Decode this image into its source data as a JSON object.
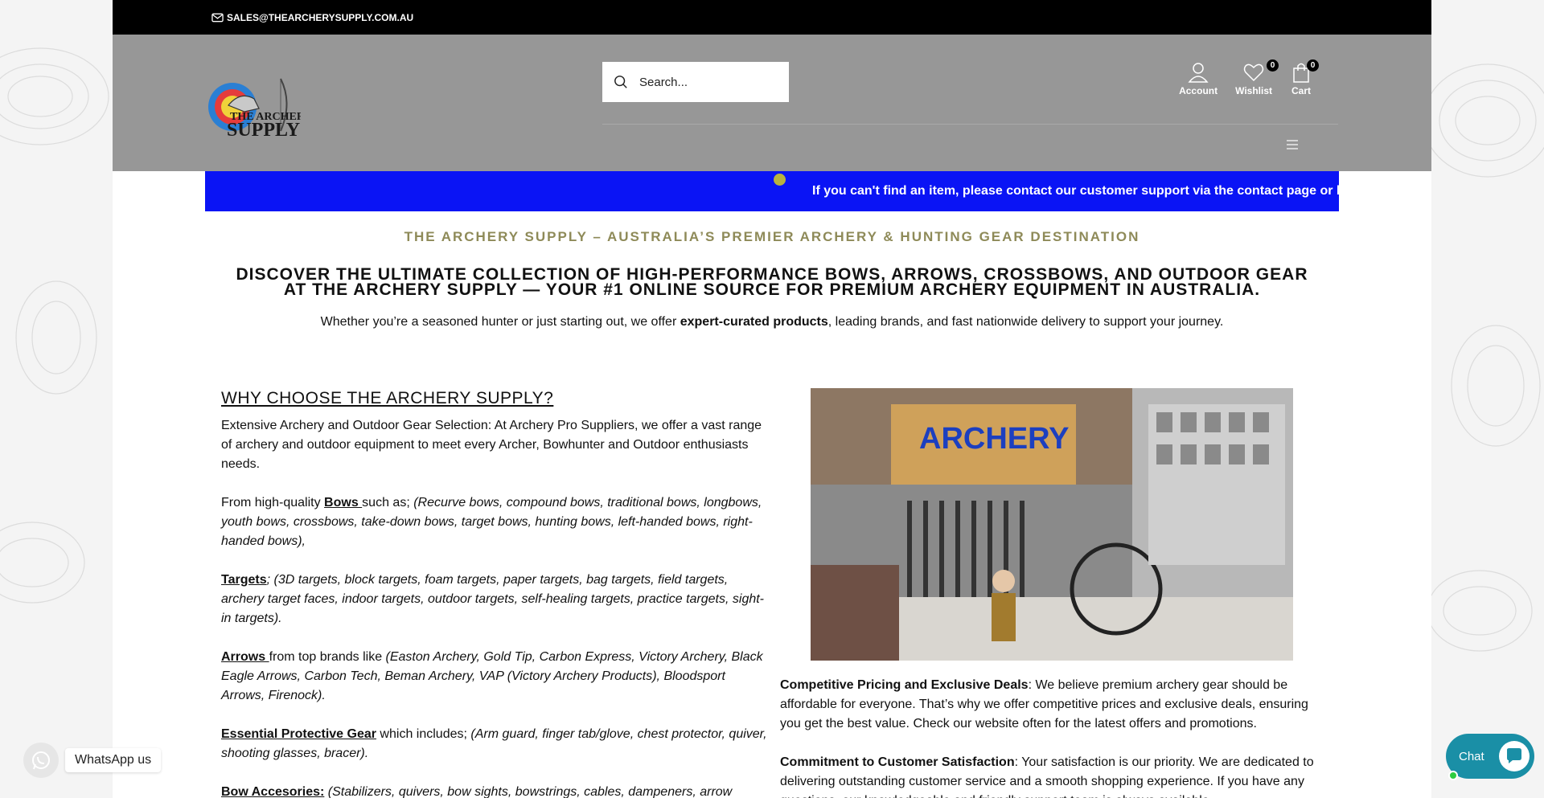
{
  "topbar": {
    "email": "SALES@THEARCHERYSUPPLY.COM.AU"
  },
  "header": {
    "logo_text_line1": "THE ARCHERY",
    "logo_text_line2": "SUPPLY",
    "search_placeholder": "Search...",
    "account_label": "Account",
    "wishlist_label": "Wishlist",
    "wishlist_count": "0",
    "cart_label": "Cart",
    "cart_count": "0"
  },
  "announcement": "If you can't find an item, please contact our customer support via the contact page or b",
  "hero": {
    "tagline": "THE ARCHERY SUPPLY – AUSTRALIA’S PREMIER ARCHERY & HUNTING GEAR DESTINATION",
    "heading": "DISCOVER THE ULTIMATE COLLECTION OF HIGH-PERFORMANCE BOWS, ARROWS, CROSSBOWS, AND OUTDOOR GEAR AT THE ARCHERY SUPPLY — YOUR #1 ONLINE SOURCE FOR PREMIUM ARCHERY EQUIPMENT IN AUSTRALIA.",
    "intro_before": "Whether you’re a seasoned hunter or just starting out, we offer ",
    "intro_bold": "expert-curated products",
    "intro_after": ", leading brands, and fast nationwide delivery to support your journey."
  },
  "why": {
    "heading": "WHY CHOOSE THE  ARCHERY SUPPLY?",
    "p1": "Extensive Archery and Outdoor Gear Selection: At Archery Pro Suppliers, we offer a vast range of archery and outdoor equipment to meet every Archer, Bowhunter and Outdoor enthusiasts needs.",
    "bows_prefix": "From high-quality ",
    "bows_link": "Bows ",
    "bows_mid": "such as; ",
    "bows_list": "(Recurve bows, compound bows, traditional bows, longbows, youth bows, crossbows, take-down bows, target bows, hunting bows, left-handed bows, right-handed bows),",
    "targets_link": "Targets",
    "targets_sep": "; ",
    "targets_list": "(3D targets, block targets, foam targets, paper targets, bag targets, field targets, archery target faces, indoor targets, outdoor targets, self-healing targets, practice targets, sight-in targets).",
    "arrows_link": "Arrows ",
    "arrows_mid": "from top brands like ",
    "arrows_list": "(Easton Archery, Gold Tip, Carbon Express, Victory Archery, Black Eagle Arrows, Carbon Tech, Beman Archery, VAP (Victory Archery Products), Bloodsport Arrows, Firenock).",
    "protective_link": "Essential Protective Gear",
    "protective_mid": " which includes; ",
    "protective_list": "(Arm guard, finger tab/glove, chest protector, quiver, shooting glasses, bracer).",
    "accessories_link": "Bow Accesories:",
    "accessories_list": " (Stabilizers, quivers, bow sights, bowstrings, cables, dampeners, arrow"
  },
  "store_image": {
    "sign_text": "ARCHERY"
  },
  "right": {
    "pricing_bold": "Competitive Pricing and Exclusive Deals",
    "pricing_text": ": We believe premium archery gear should be affordable for everyone. That’s why we offer competitive prices and exclusive deals, ensuring you get the best value. Check our website often for the latest offers and promotions.",
    "satisfaction_bold": "Commitment to Customer Satisfaction",
    "satisfaction_text": ": Your satisfaction is our priority. We are dedicated to delivering outstanding customer service and a smooth shopping experience. If you have any questions, our knowledgeable and friendly support team is always available."
  },
  "widgets": {
    "whatsapp_label": "WhatsApp us",
    "chat_label": "Chat"
  },
  "colors": {
    "announcement_bg": "#0a14f5",
    "header_bg": "#979797",
    "tagline": "#8e8a58",
    "chat": "#1a8fa6"
  },
  "icons": [
    "mail-icon",
    "search-icon",
    "account-icon",
    "wishlist-heart-icon",
    "cart-bag-icon",
    "hamburger-menu-icon",
    "whatsapp-icon",
    "chat-bubble-icon"
  ]
}
